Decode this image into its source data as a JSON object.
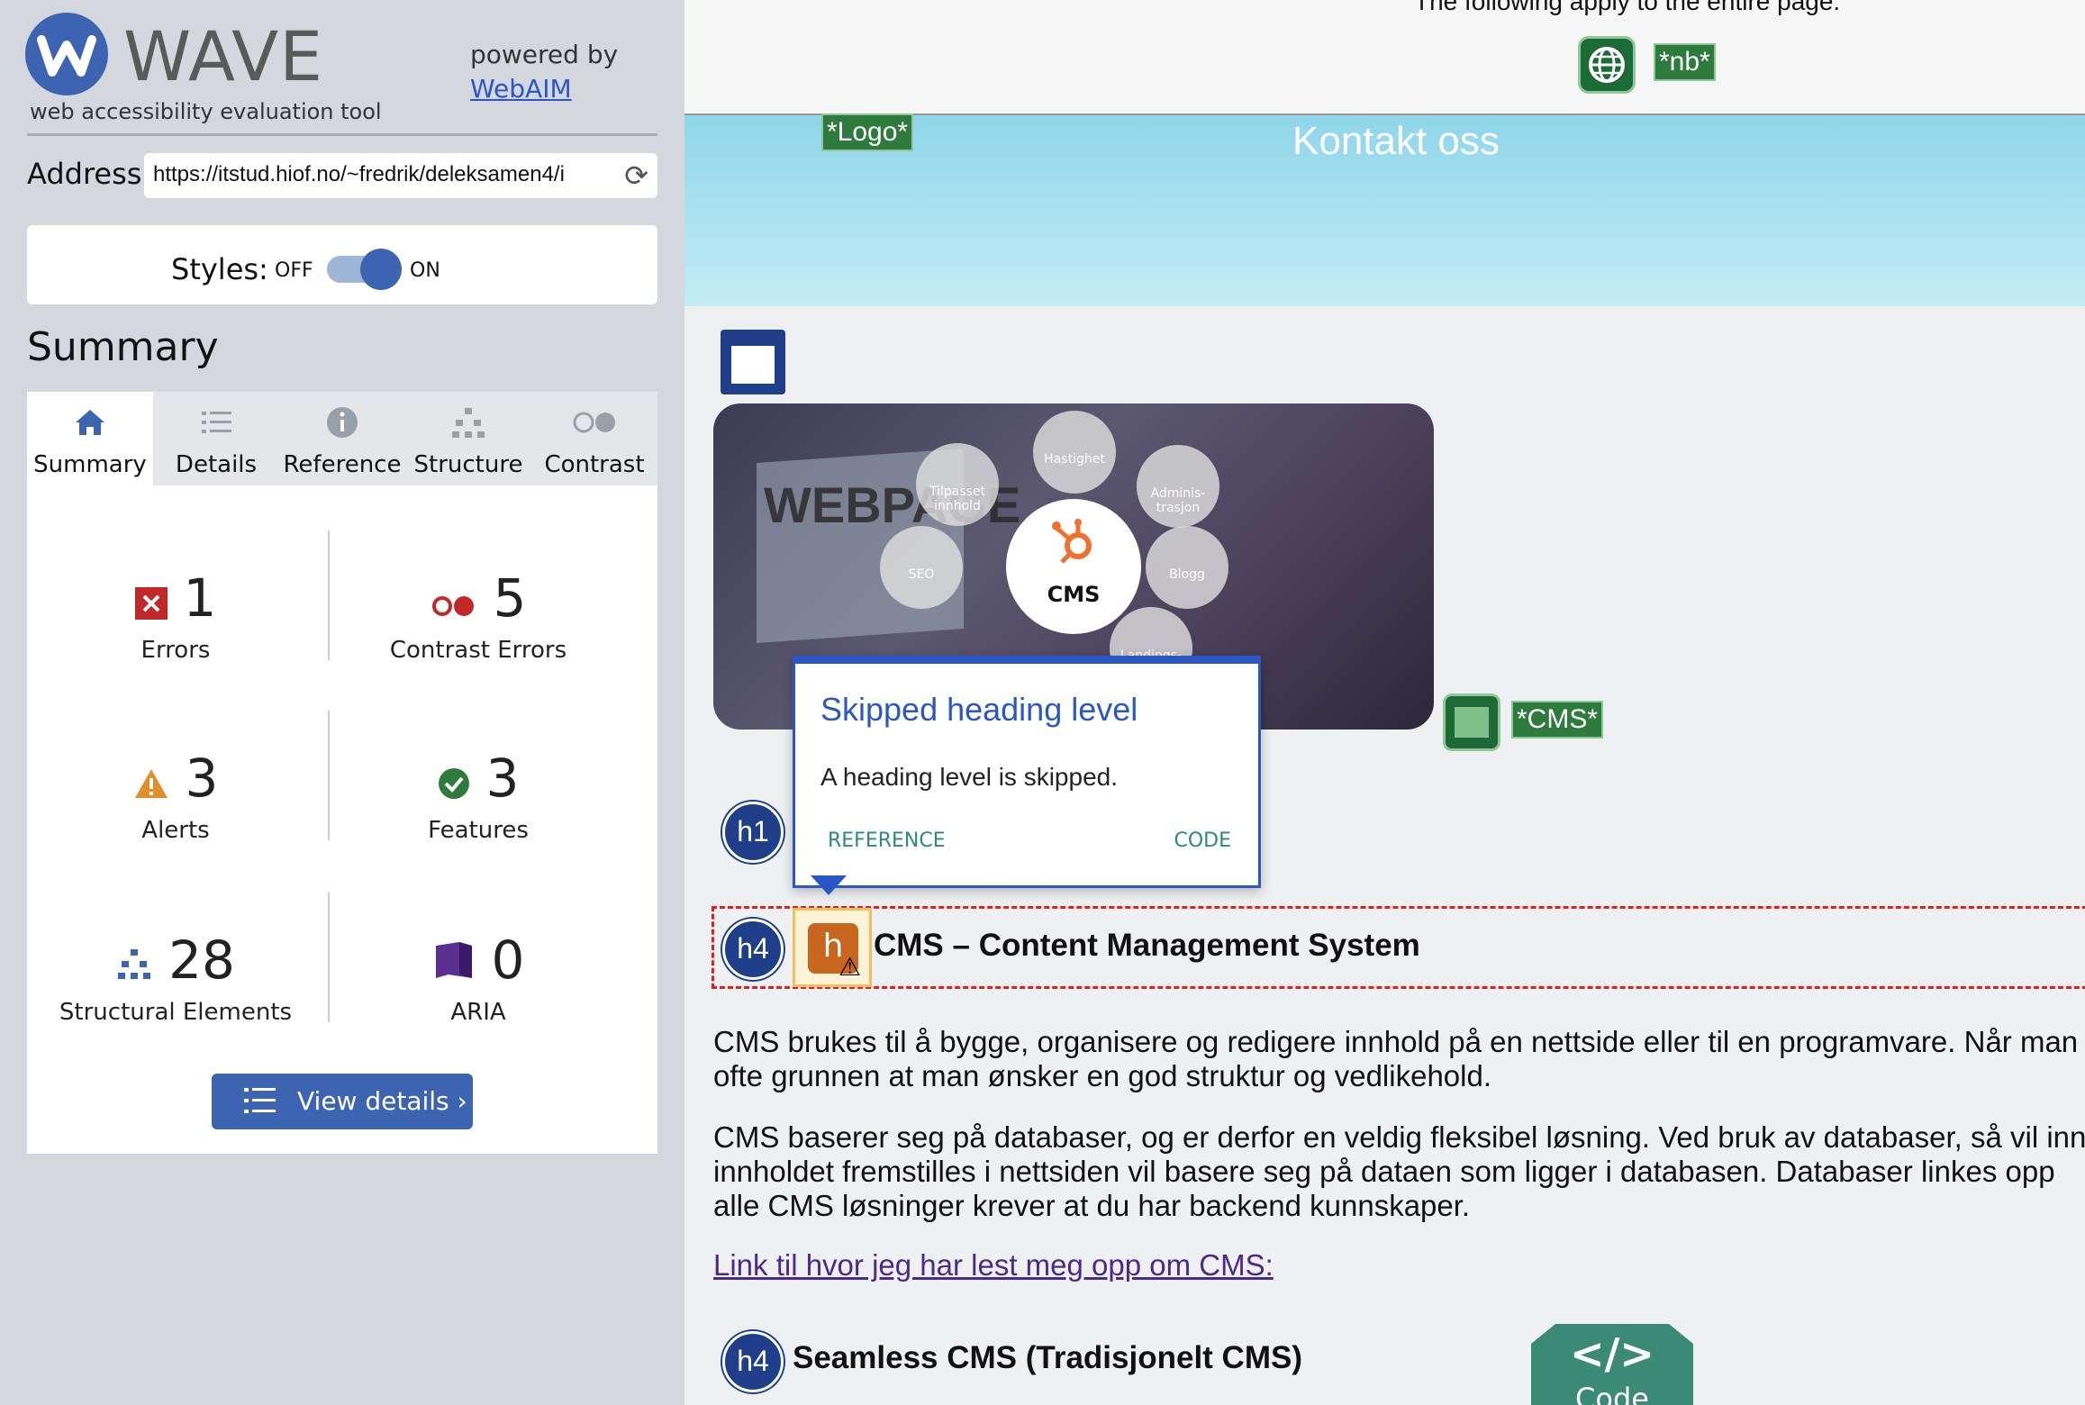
{
  "sidebar": {
    "logo_text": "WAVE",
    "logo_tagline": "web accessibility evaluation tool",
    "powered_by": "powered by",
    "powered_link": "WebAIM",
    "address_label": "Address:",
    "address_value": "https://itstud.hiof.no/~fredrik/deleksamen4/i",
    "styles_label": "Styles:",
    "styles_off": "OFF",
    "styles_on": "ON",
    "styles_state": "on",
    "summary_title": "Summary",
    "tabs": [
      {
        "label": "Summary",
        "icon": "home-icon",
        "active": true
      },
      {
        "label": "Details",
        "icon": "list-icon"
      },
      {
        "label": "Reference",
        "icon": "info-icon"
      },
      {
        "label": "Structure",
        "icon": "hierarchy-icon"
      },
      {
        "label": "Contrast",
        "icon": "contrast-icon"
      }
    ],
    "stats": {
      "errors": {
        "count": "1",
        "label": "Errors"
      },
      "contrast": {
        "count": "5",
        "label": "Contrast Errors"
      },
      "alerts": {
        "count": "3",
        "label": "Alerts"
      },
      "features": {
        "count": "3",
        "label": "Features"
      },
      "structural": {
        "count": "28",
        "label": "Structural Elements"
      },
      "aria": {
        "count": "0",
        "label": "ARIA"
      }
    },
    "view_details": "View details ›"
  },
  "page": {
    "apply_text": "The following apply to the entire page:",
    "nb_tag": "*nb*",
    "logo_tag": "*Logo*",
    "banner_title": "Kontakt oss",
    "hero": {
      "webpage_text": "WEBPAGE",
      "center_label": "CMS",
      "bubbles": [
        "Hastighet",
        "Adminis-trasjon",
        "Blogg",
        "Landings-",
        "SEO",
        "Tilpasset innhold"
      ]
    },
    "cms_tag": "*CMS*",
    "popup": {
      "title": "Skipped heading level",
      "description": "A heading level is skipped.",
      "reference": "REFERENCE",
      "code": "CODE"
    },
    "h1_badge": "h1",
    "h4_badge": "h4",
    "heading": "CMS – Content Management System",
    "para1_l1": "CMS brukes til å bygge, organisere og redigere innhold på en nettside eller til en programvare. Når man",
    "para1_l2": "ofte grunnen at man ønsker en god struktur og vedlikehold.",
    "para2_l1": "CMS baserer seg på databaser, og er derfor en veldig fleksibel løsning. Ved bruk av databaser, så vil inn",
    "para2_l2": "innholdet fremstilles i nettsiden vil basere seg på dataen som ligger i databasen. Databaser linkes opp",
    "para2_l3": "alle CMS løsninger krever at du har backend kunnskaper.",
    "link_text": "Link til hvor jeg har lest meg opp om CMS:",
    "h4_badge2": "h4",
    "seamless_heading": "Seamless CMS (Tradisjonelt CMS)",
    "code_badge_symbol": "</>",
    "code_badge_label": "Code"
  },
  "colors": {
    "accent": "#3c64b0",
    "error": "#c0282a",
    "alert": "#e0902a",
    "feature": "#2f7a3d",
    "popup_border": "#2a56c6"
  }
}
